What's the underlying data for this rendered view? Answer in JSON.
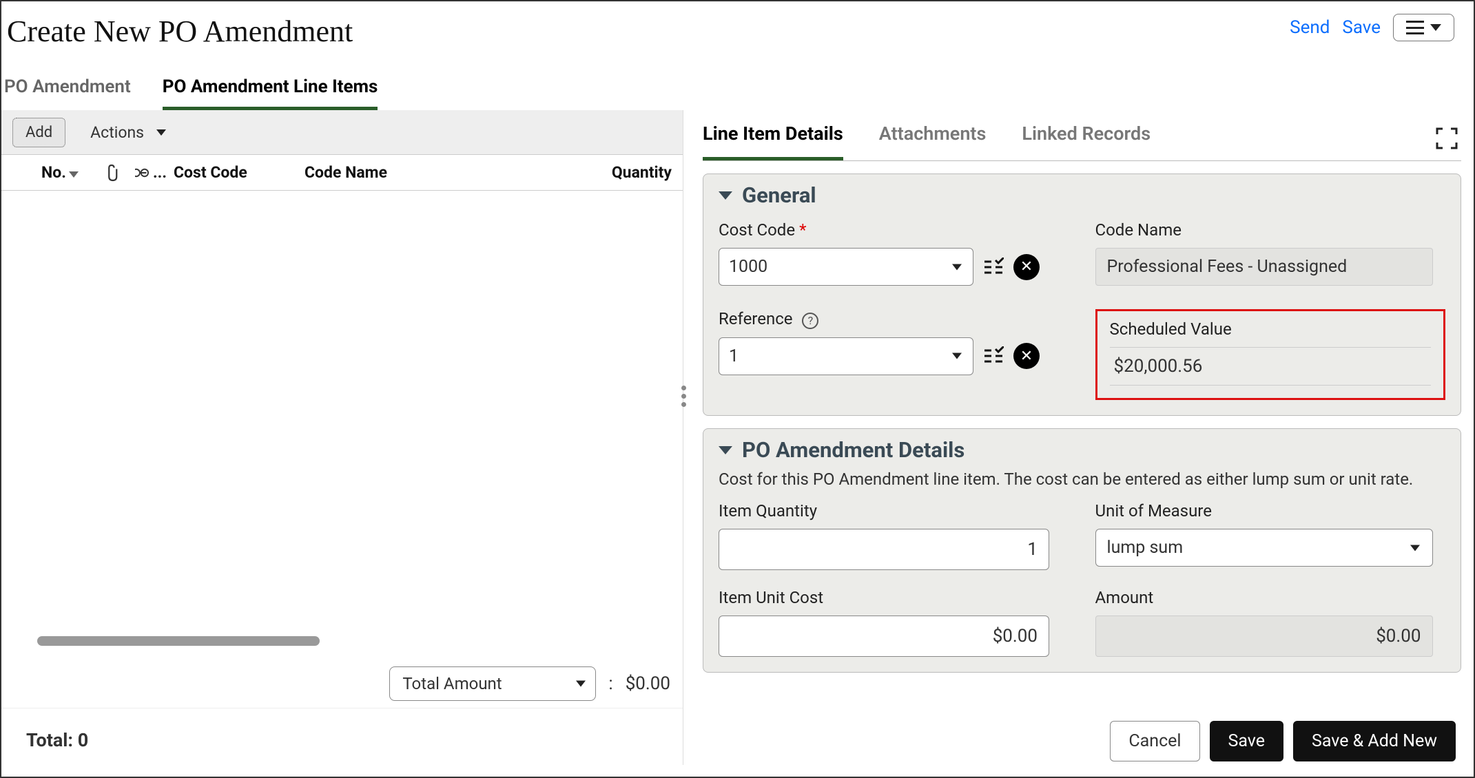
{
  "header": {
    "title": "Create New PO Amendment",
    "send": "Send",
    "save": "Save"
  },
  "primary_tabs": {
    "amendment": "PO Amendment",
    "line_items": "PO Amendment Line Items"
  },
  "left": {
    "add": "Add",
    "actions": "Actions",
    "columns": {
      "no": "No.",
      "cost_code": "Cost Code",
      "code_name": "Code Name",
      "quantity": "Quantity",
      "link_ellipsis": "..."
    },
    "total_amount_label": "Total Amount",
    "colon": ":",
    "total_amount_value": "$0.00",
    "total_label": "Total:",
    "total_value": "0"
  },
  "detail_tabs": {
    "details": "Line Item Details",
    "attachments": "Attachments",
    "linked": "Linked Records"
  },
  "general": {
    "heading": "General",
    "cost_code_label": "Cost Code",
    "cost_code_value": "1000",
    "code_name_label": "Code Name",
    "code_name_value": "Professional Fees - Unassigned",
    "reference_label": "Reference",
    "reference_value": "1",
    "scheduled_label": "Scheduled Value",
    "scheduled_value": "$20,000.56"
  },
  "po_details": {
    "heading": "PO Amendment Details",
    "desc": "Cost for this PO Amendment line item. The cost can be entered as either lump sum or unit rate.",
    "item_qty_label": "Item Quantity",
    "item_qty_value": "1",
    "uom_label": "Unit of Measure",
    "uom_value": "lump sum",
    "item_unit_cost_label": "Item Unit Cost",
    "item_unit_cost_value": "$0.00",
    "amount_label": "Amount",
    "amount_value": "$0.00"
  },
  "footer": {
    "cancel": "Cancel",
    "save": "Save",
    "save_add": "Save & Add New"
  }
}
